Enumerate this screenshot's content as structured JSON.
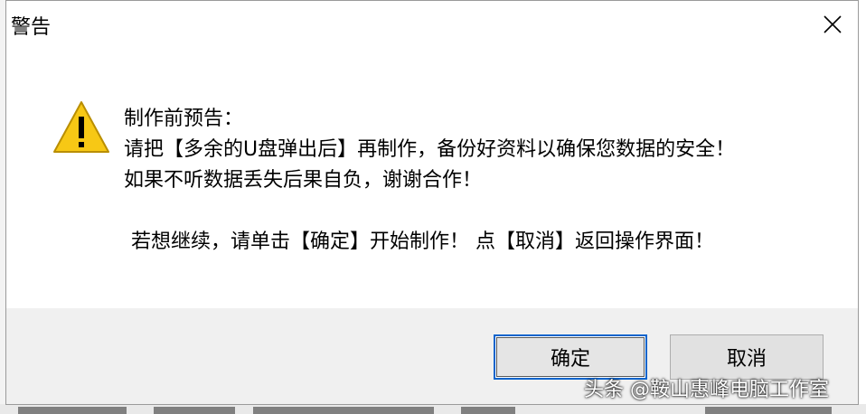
{
  "dialog": {
    "title": "警告",
    "messages": {
      "heading": "制作前预告：",
      "line1": "请把【多余的U盘弹出后】再制作，备份好资料以确保您数据的安全！",
      "line2": "如果不听数据丢失后果自负，谢谢合作！",
      "line3": "若想继续，请单击【确定】开始制作！ 点【取消】返回操作界面！"
    },
    "buttons": {
      "ok_label": "确定",
      "cancel_label": "取消"
    }
  },
  "icons": {
    "close": "close-icon",
    "warning": "warning-icon"
  },
  "colors": {
    "warning_yellow": "#f7c815",
    "focus_border": "#0a64cc",
    "footer_bg": "#f0f0f0"
  },
  "watermark": "头条 @鞍山惠峰电脑工作室"
}
